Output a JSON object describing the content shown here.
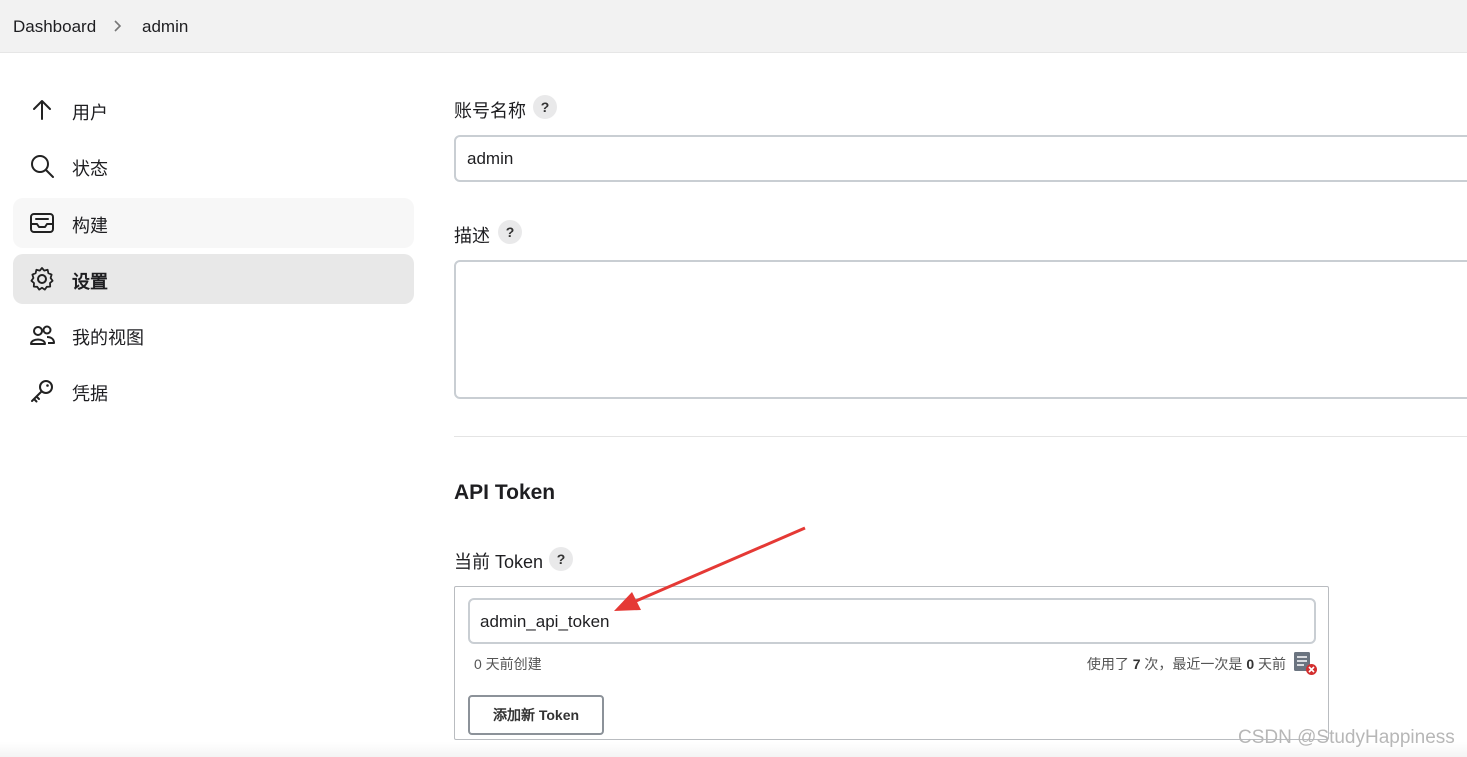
{
  "breadcrumb": {
    "items": [
      "Dashboard",
      "admin"
    ]
  },
  "sidebar": {
    "items": [
      {
        "label": "用户",
        "icon": "arrow-up-icon"
      },
      {
        "label": "状态",
        "icon": "search-icon"
      },
      {
        "label": "构建",
        "icon": "inbox-icon"
      },
      {
        "label": "设置",
        "icon": "gear-icon",
        "active": true
      },
      {
        "label": "我的视图",
        "icon": "people-icon"
      },
      {
        "label": "凭据",
        "icon": "key-icon"
      }
    ]
  },
  "form": {
    "account_name": {
      "label": "账号名称",
      "help": "?",
      "value": "admin"
    },
    "description": {
      "label": "描述",
      "help": "?",
      "value": ""
    }
  },
  "api_token": {
    "title": "API Token",
    "current_label": "当前 Token",
    "help": "?",
    "token_name": "admin_api_token",
    "created": "0 天前创建",
    "usage_prefix": "使用了",
    "usage_count": "7",
    "usage_mid": "次，最近一次是",
    "last_used_days": "0",
    "usage_suffix": "天前",
    "add_button": "添加新 Token"
  },
  "watermark": "CSDN @StudyHappiness",
  "colors": {
    "active_nav": "#e8e8e8",
    "annotation_arrow": "#e53935",
    "revoke_red": "#d32f2f"
  }
}
